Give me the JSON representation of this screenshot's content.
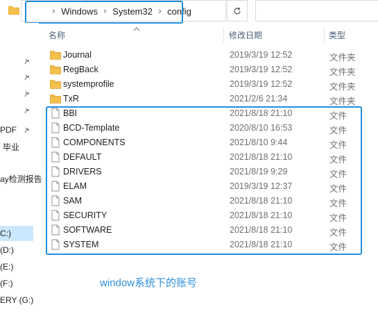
{
  "address_bar": {
    "crumbs": [
      "Windows",
      "System32",
      "config"
    ]
  },
  "columns": {
    "name": "名称",
    "modified": "修改日期",
    "type": "类型"
  },
  "nav": {
    "items": [
      {
        "label": "PDF",
        "pinned": true
      },
      {
        "label": "毕业",
        "pinned": false
      },
      {
        "label": "ay检测报告",
        "pinned": false
      },
      {
        "label": "C:)",
        "selected": true
      },
      {
        "label": "(D:)"
      },
      {
        "label": "(E:)"
      },
      {
        "label": "(F:)"
      },
      {
        "label": "ERY (G:)"
      }
    ]
  },
  "files": [
    {
      "name": "Journal",
      "date": "2019/3/19 12:52",
      "type": "文件夹",
      "kind": "folder"
    },
    {
      "name": "RegBack",
      "date": "2019/3/19 12:52",
      "type": "文件夹",
      "kind": "folder"
    },
    {
      "name": "systemprofile",
      "date": "2019/3/19 12:52",
      "type": "文件夹",
      "kind": "folder"
    },
    {
      "name": "TxR",
      "date": "2021/2/6 21:34",
      "type": "文件夹",
      "kind": "folder"
    },
    {
      "name": "BBI",
      "date": "2021/8/18 21:10",
      "type": "文件",
      "kind": "file"
    },
    {
      "name": "BCD-Template",
      "date": "2020/8/10 16:53",
      "type": "文件",
      "kind": "file"
    },
    {
      "name": "COMPONENTS",
      "date": "2021/8/10 9:44",
      "type": "文件",
      "kind": "file"
    },
    {
      "name": "DEFAULT",
      "date": "2021/8/18 21:10",
      "type": "文件",
      "kind": "file"
    },
    {
      "name": "DRIVERS",
      "date": "2021/8/19 9:29",
      "type": "文件",
      "kind": "file"
    },
    {
      "name": "ELAM",
      "date": "2019/3/19 12:37",
      "type": "文件",
      "kind": "file"
    },
    {
      "name": "SAM",
      "date": "2021/8/18 21:10",
      "type": "文件",
      "kind": "file"
    },
    {
      "name": "SECURITY",
      "date": "2021/8/18 21:10",
      "type": "文件",
      "kind": "file"
    },
    {
      "name": "SOFTWARE",
      "date": "2021/8/18 21:10",
      "type": "文件",
      "kind": "file"
    },
    {
      "name": "SYSTEM",
      "date": "2021/8/18 21:10",
      "type": "文件",
      "kind": "file"
    }
  ],
  "caption": "window系统下的账号",
  "colors": {
    "highlight": "#1e90dc",
    "folder": "#f4c04c",
    "caption": "#2d8fe0",
    "selection": "#cce8ff"
  }
}
